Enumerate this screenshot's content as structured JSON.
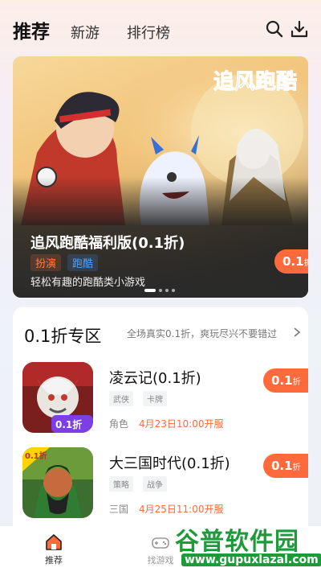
{
  "header": {
    "tabs": [
      {
        "label": "推荐",
        "active": true
      },
      {
        "label": "新游",
        "active": false
      },
      {
        "label": "排行榜",
        "active": false
      }
    ],
    "icons": [
      "search-icon",
      "download-icon"
    ]
  },
  "banner": {
    "art_text": "追风跑酷",
    "title": "追风跑酷福利版(0.1折)",
    "tags": [
      "扮演",
      "跑酷"
    ],
    "description": "轻松有趣的跑酷类小游戏",
    "badge_value": "0.1",
    "badge_unit": "折",
    "slides_total": 4,
    "slide_active_index": 0
  },
  "section": {
    "title": "0.1折专区",
    "more": "全场真实0.1折，爽玩尽兴不要错过",
    "games": [
      {
        "name": "凌云记(0.1折)",
        "tags": [
          "武侠",
          "卡牌"
        ],
        "category": "角色",
        "date": "4月23日10:00开服",
        "badge_value": "0.1",
        "badge_unit": "折",
        "icon_label": "0.1折"
      },
      {
        "name": "大三国时代(0.1折)",
        "tags": [
          "策略",
          "战争"
        ],
        "category": "三国",
        "date": "4月25日11:00开服",
        "badge_value": "0.1",
        "badge_unit": "折",
        "icon_label": "0.1折"
      }
    ]
  },
  "bottom_nav": [
    {
      "label": "推荐",
      "icon": "home-icon",
      "active": true
    },
    {
      "label": "找游戏",
      "icon": "gamepad-icon",
      "active": false
    }
  ],
  "watermark": {
    "text": "谷普软件园",
    "url": "www.gupuxlazal.com"
  },
  "colors": {
    "accent": "#ff6a3c",
    "tag_orange": "#ff7a45",
    "tag_blue": "#4aa3ff",
    "watermark_green": "#1e9a3a"
  }
}
